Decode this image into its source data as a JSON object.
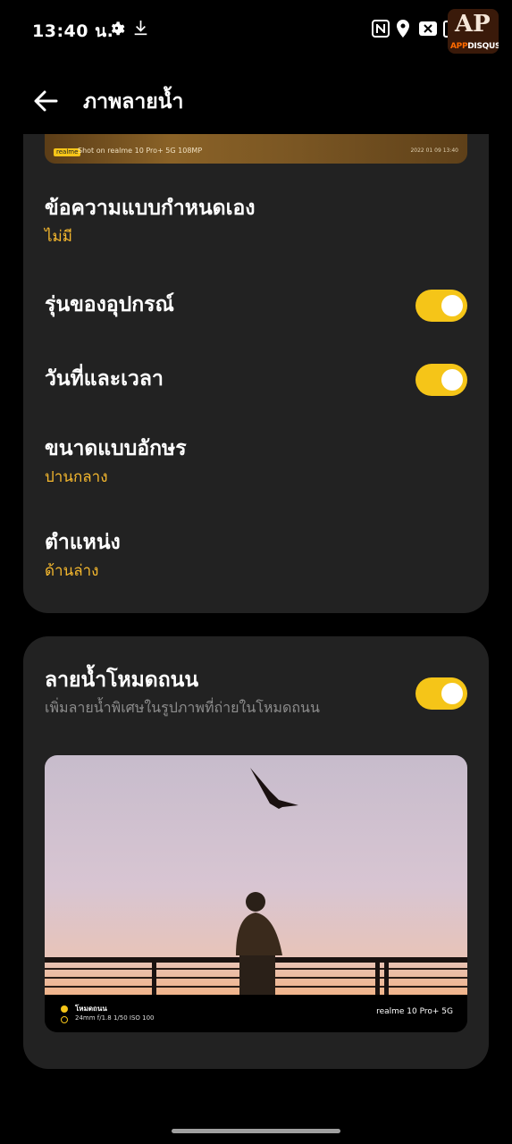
{
  "status_bar": {
    "time": "13:40 น.",
    "left_icons": [
      "gear-icon",
      "download-icon"
    ],
    "right_icons": [
      "nfc-icon",
      "location-icon",
      "close-box-icon",
      "battery-icon"
    ],
    "badge": {
      "mark": "AP",
      "text_orange": "APP",
      "text_white": "DISQUS"
    }
  },
  "header": {
    "back_icon": "arrow-left-icon",
    "title": "ภาพลายน้ำ"
  },
  "preview_strip": {
    "brand": "realme",
    "caption": "Shot on realme 10 Pro+ 5G 108MP",
    "date": "2022 01 09 13:40"
  },
  "settings": {
    "custom_text": {
      "title": "ข้อความแบบกำหนดเอง",
      "value": "ไม่มี"
    },
    "device_model": {
      "title": "รุ่นของอุปกรณ์",
      "enabled": true
    },
    "date_time": {
      "title": "วันที่และเวลา",
      "enabled": true
    },
    "font_size": {
      "title": "ขนาดแบบอักษร",
      "value": "ปานกลาง"
    },
    "position": {
      "title": "ตำแหน่ง",
      "value": "ด้านล่าง"
    }
  },
  "street_mode": {
    "title": "ลายน้ำโหมดถนน",
    "subtitle": "เพิ่มลายน้ำพิเศษในรูปภาพที่ถ่ายในโหมดถนน",
    "enabled": true,
    "photo_footer": {
      "mode": "โหมดถนน",
      "params": "24mm f/1.8 1/50 ISO 100",
      "model": "realme 10 Pro+ 5G"
    }
  },
  "colors": {
    "accent": "#f5c518",
    "value_text": "#f5b82e",
    "card_bg": "#222222",
    "page_bg": "#000000"
  }
}
